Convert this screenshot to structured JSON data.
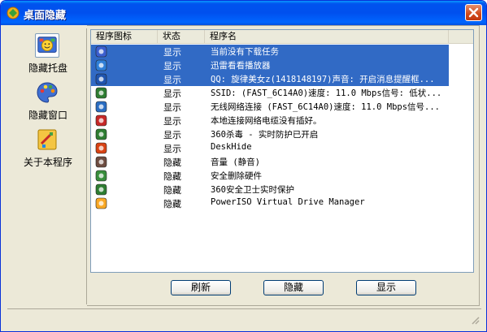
{
  "window": {
    "title": "桌面隐藏",
    "close_label": "close"
  },
  "sidebar": {
    "items": [
      {
        "label": "隐藏托盘",
        "icon": "tray-icon",
        "selected": true
      },
      {
        "label": "隐藏窗口",
        "icon": "palette-icon",
        "selected": false
      },
      {
        "label": "关于本程序",
        "icon": "about-icon",
        "selected": false
      }
    ]
  },
  "list": {
    "columns": [
      "程序图标",
      "状态",
      "程序名"
    ],
    "rows": [
      {
        "icon": "download-arrow-icon",
        "status": "显示",
        "name": "当前没有下载任务",
        "selected": true
      },
      {
        "icon": "thunder-icon",
        "status": "显示",
        "name": "迅雷看看播放器",
        "selected": true
      },
      {
        "icon": "qq-icon",
        "status": "显示",
        "name": "QQ: 旋律美女z(1418148197)声音: 开启消息提醒框...",
        "selected": true
      },
      {
        "icon": "wifi-signal-icon",
        "status": "显示",
        "name": "SSID: (FAST_6C14A0)速度: 11.0 Mbps信号: 低状...",
        "selected": false
      },
      {
        "icon": "wireless-network-icon",
        "status": "显示",
        "name": "无线网络连接 (FAST_6C14A0)速度: 11.0 Mbps信号...",
        "selected": false
      },
      {
        "icon": "network-disconnected-icon",
        "status": "显示",
        "name": "本地连接网络电缆没有插好。",
        "selected": false
      },
      {
        "icon": "shield-360-icon",
        "status": "显示",
        "name": "360杀毒 - 实时防护已开启",
        "selected": false
      },
      {
        "icon": "deskhide-icon",
        "status": "显示",
        "name": "DeskHide",
        "selected": false
      },
      {
        "icon": "speaker-muted-icon",
        "status": "隐藏",
        "name": "音量 (静音)",
        "selected": false
      },
      {
        "icon": "safely-remove-hardware-icon",
        "status": "隐藏",
        "name": "安全删除硬件",
        "selected": false
      },
      {
        "icon": "guard-360-icon",
        "status": "隐藏",
        "name": "360安全卫士实时保护",
        "selected": false
      },
      {
        "icon": "poweriso-icon",
        "status": "隐藏",
        "name": "PowerISO Virtual Drive Manager",
        "selected": false
      }
    ]
  },
  "buttons": {
    "refresh": "刷新",
    "hide": "隐藏",
    "show": "显示"
  },
  "colors": {
    "selection": "#316ac5",
    "titlebar": "#0053ee"
  }
}
